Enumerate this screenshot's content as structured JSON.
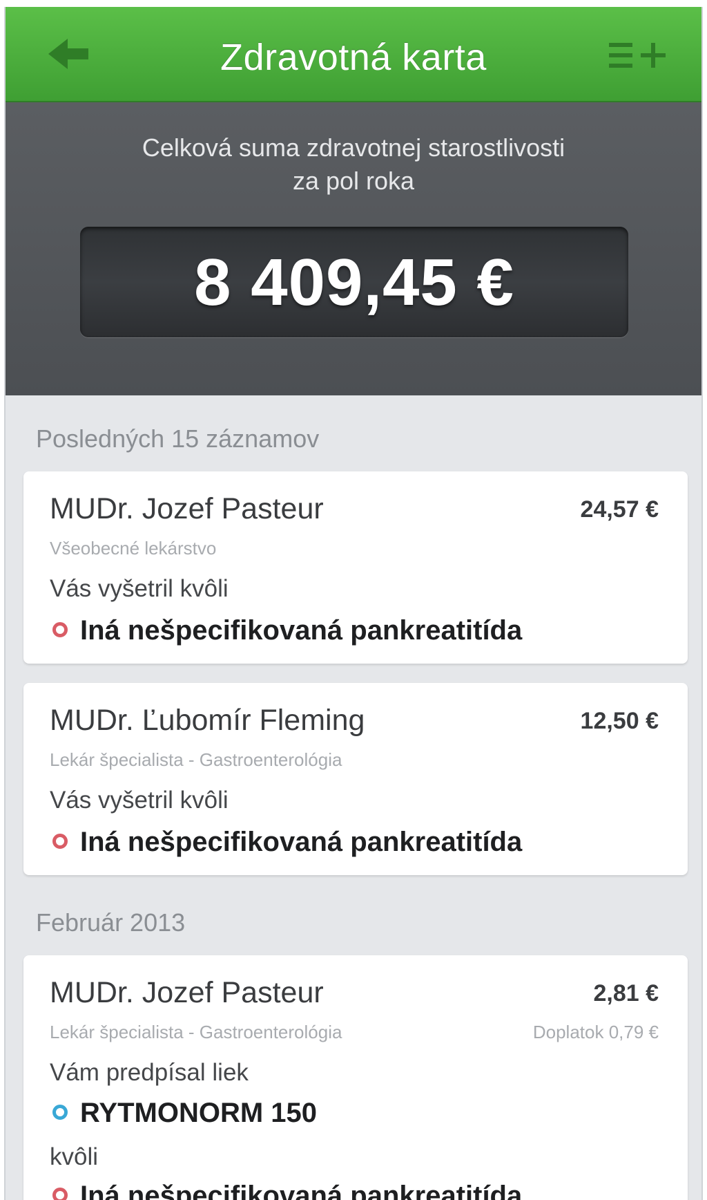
{
  "nav": {
    "title": "Zdravotná karta",
    "back_icon": "arrow-left-icon",
    "menu_add_icon": "list-add-icon",
    "background": "#4cae3e"
  },
  "summary": {
    "label_line1": "Celková suma zdravotnej starostlivosti",
    "label_line2": "za pol roka",
    "total": "8 409,45 €"
  },
  "sections": [
    {
      "title": "Posledných 15 záznamov",
      "records": [
        {
          "doctor": "MUDr. Jozef Pasteur",
          "specialty": "Všeobecné lekárstvo",
          "price": "24,57 €",
          "reason_label": "Vás vyšetril kvôli",
          "diagnosis": "Iná nešpecifikovaná pankreatitída",
          "diagnosis_icon": "red-circle-icon"
        },
        {
          "doctor": "MUDr. Ľubomír Fleming",
          "specialty": "Lekár špecialista - Gastroenterológia",
          "price": "12,50 €",
          "reason_label": "Vás vyšetril kvôli",
          "diagnosis": "Iná nešpecifikovaná pankreatitída",
          "diagnosis_icon": "red-circle-icon"
        }
      ]
    },
    {
      "title": "Február 2013",
      "records": [
        {
          "doctor": "MUDr. Jozef Pasteur",
          "specialty": "Lekár špecialista - Gastroenterológia",
          "price": "2,81 €",
          "copay": "Doplatok 0,79 €",
          "reason_label": "Vám predpísal liek",
          "medication": "RYTMONORM 150",
          "medication_icon": "blue-circle-icon",
          "because_label": "kvôli",
          "diagnosis": "Iná nešpecifikovaná pankreatitída",
          "diagnosis_icon": "red-circle-icon"
        }
      ]
    }
  ],
  "colors": {
    "accent_green": "#4cae3e",
    "summary_bg": "#55585c",
    "list_bg": "#e5e7ea",
    "diagnosis_dot": "#d95c65",
    "medication_dot": "#39a8d6"
  }
}
